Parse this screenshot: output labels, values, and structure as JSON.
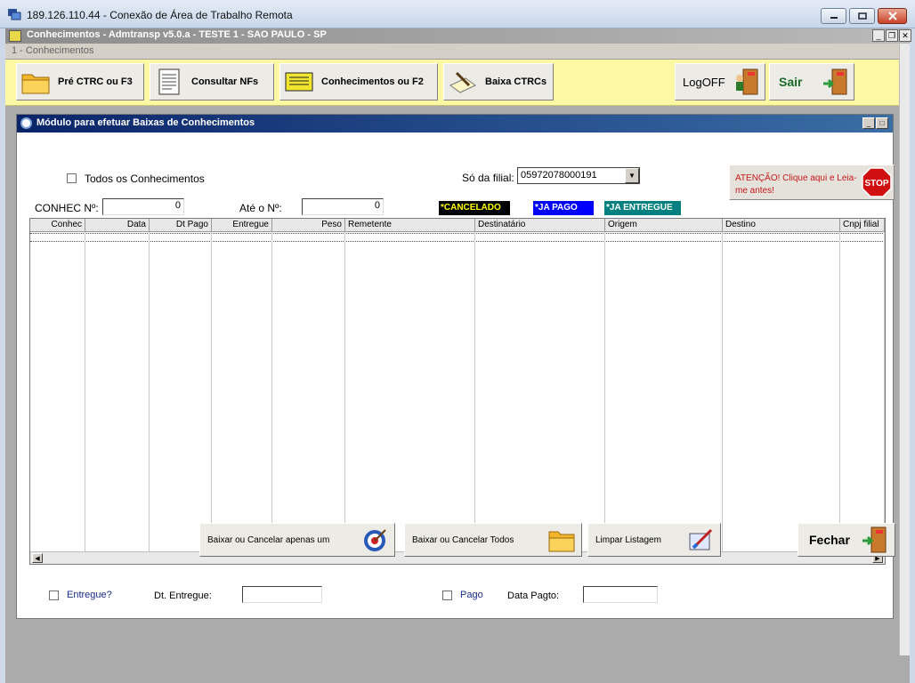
{
  "window": {
    "title": "189.126.110.44 - Conexão de Área de Trabalho Remota"
  },
  "app": {
    "title": "Conhecimentos - Admtransp v5.0.a - TESTE 1 - SAO PAULO - SP",
    "menu_item": "1 - Conhecimentos"
  },
  "toolbar": {
    "pre_ctrc": "Pré CTRC ou F3",
    "consultar_nfs": "Consultar NFs",
    "conhecimentos": "Conhecimentos ou F2",
    "baixa_ctrcs": "Baixa CTRCs",
    "logoff": "LogOFF",
    "sair": "Sair"
  },
  "module": {
    "title": "Módulo para efetuar Baixas de Conhecimentos",
    "todos_label": "Todos os Conhecimentos",
    "filial_label": "Só da filial:",
    "filial_value": "05972078000191",
    "atencao": "ATENÇÃO! Clique aqui e Leia-me antes!",
    "stop_text": "STOP",
    "conhec_label": "CONHEC Nº:",
    "conhec_value": "0",
    "ate_label": "Até o Nº:",
    "ate_value": "0",
    "legend": {
      "cancelado": "*CANCELADO",
      "pago": "*JA PAGO",
      "entregue": "*JA ENTREGUE",
      "colors": {
        "cancelado": "#000000",
        "pago": "#0000ff",
        "entregue": "#008080"
      }
    },
    "columns": [
      "Conhec",
      "Data",
      "Dt Pago",
      "Entregue",
      "Peso",
      "Remetente",
      "Destinatário",
      "Origem",
      "Destino",
      "Cnpj filial"
    ],
    "entregue_label": "Entregue?",
    "dt_entregue_label": "Dt. Entregue:",
    "dt_entregue_value": "",
    "pago_label": "Pago",
    "data_pagto_label": "Data Pagto:",
    "data_pagto_value": "",
    "buttons": {
      "baixar_um": "Baixar ou Cancelar apenas um",
      "baixar_todos": "Baixar ou Cancelar Todos",
      "limpar": "Limpar Listagem",
      "fechar": "Fechar"
    }
  }
}
